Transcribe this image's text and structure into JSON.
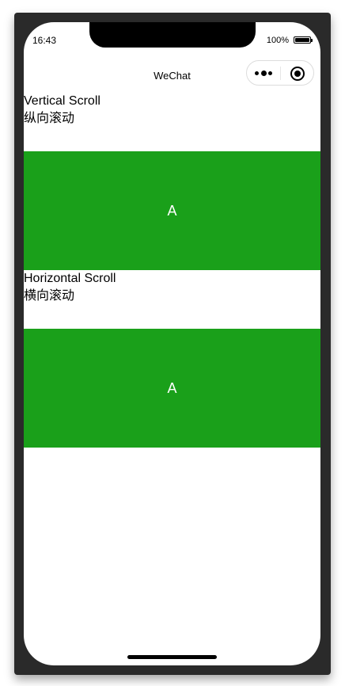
{
  "status_bar": {
    "time": "16:43",
    "battery": "100%"
  },
  "nav": {
    "title": "WeChat",
    "menu_icon": "more-dots-icon",
    "close_icon": "target-circle-icon"
  },
  "sections": [
    {
      "title": "Vertical Scroll",
      "subtitle": "纵向滚动",
      "item_label": "A"
    },
    {
      "title": "Horizontal Scroll",
      "subtitle": "横向滚动",
      "item_label": "A"
    }
  ],
  "colors": {
    "item_background": "#1AA01A",
    "item_text": "#FFFFFF",
    "device_frame": "#2A2A2A"
  }
}
